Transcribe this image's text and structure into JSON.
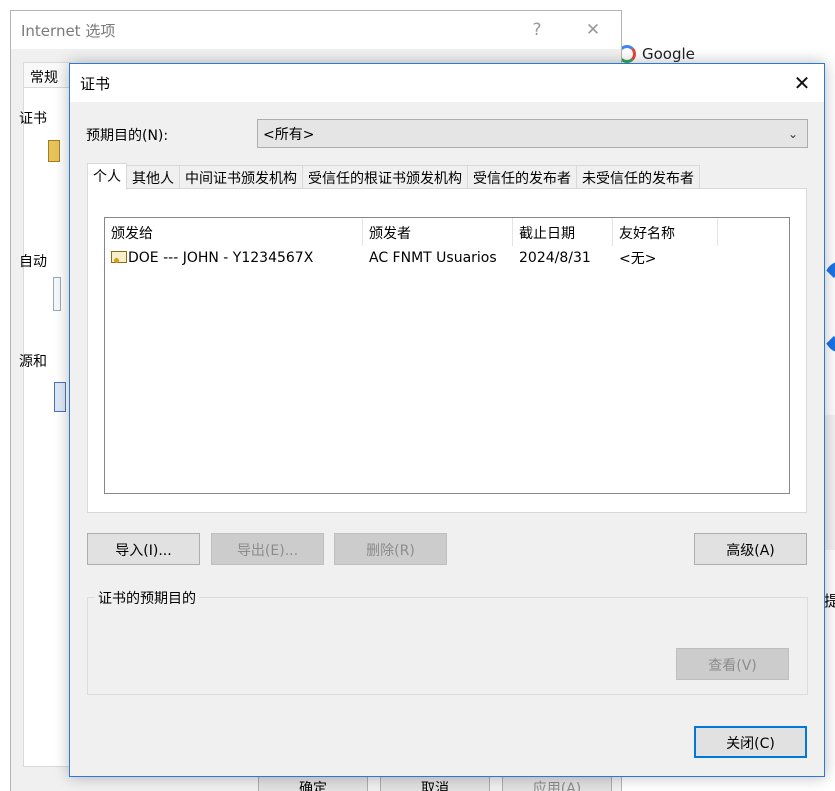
{
  "background": {
    "google_text": "Google",
    "right_edge_char": "提"
  },
  "internet_options": {
    "title": "Internet 选项",
    "help_glyph": "?",
    "close_glyph": "✕",
    "tab_general": "常规",
    "section_cert": "证书",
    "section_auto": "自动",
    "section_source": "源和",
    "btn_ok": "确定",
    "btn_cancel": "取消",
    "btn_apply": "应用(A)"
  },
  "cert_dialog": {
    "title": "证书",
    "close_glyph": "✕",
    "purpose_label": "预期目的(N):",
    "purpose_value": "<所有>",
    "tabs": [
      {
        "label": "个人"
      },
      {
        "label": "其他人"
      },
      {
        "label": "中间证书颁发机构"
      },
      {
        "label": "受信任的根证书颁发机构"
      },
      {
        "label": "受信任的发布者"
      },
      {
        "label": "未受信任的发布者"
      }
    ],
    "columns": {
      "issued_to": "颁发给",
      "issued_by": "颁发者",
      "expiration": "截止日期",
      "friendly_name": "友好名称"
    },
    "rows": [
      {
        "issued_to": "DOE --- JOHN - Y1234567X",
        "issued_by": "AC FNMT Usuarios",
        "expiration": "2024/8/31",
        "friendly_name": "<无>"
      }
    ],
    "buttons": {
      "import": "导入(I)...",
      "export": "导出(E)...",
      "remove": "删除(R)",
      "advanced": "高级(A)",
      "view": "查看(V)",
      "close": "关闭(C)"
    },
    "purposes_group_label": "证书的预期目的"
  }
}
